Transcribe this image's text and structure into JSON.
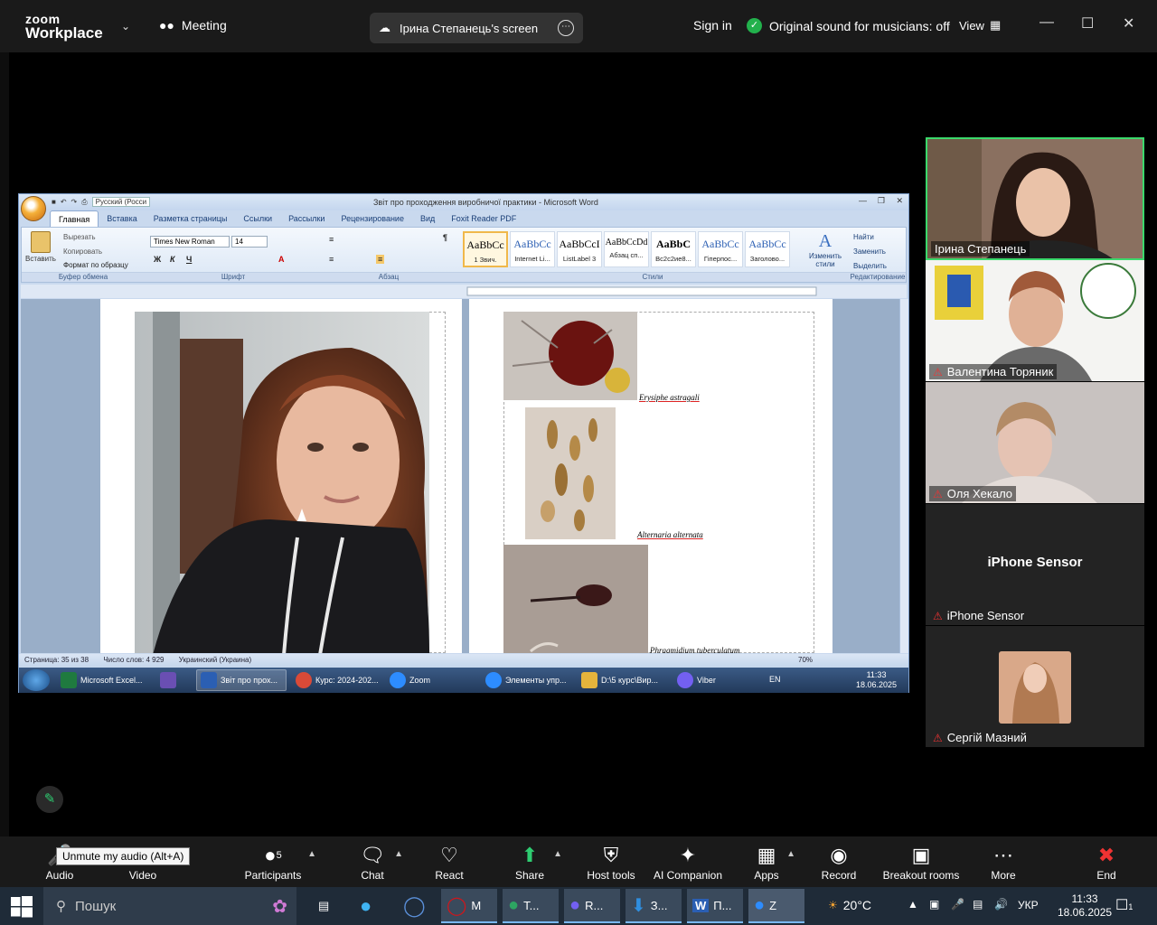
{
  "zoom": {
    "logo_line1": "zoom",
    "logo_line2": "Workplace",
    "meeting_label": "Meeting",
    "share_title": "Ірина Степанець's screen",
    "signin": "Sign in",
    "orig_sound": "Original sound for musicians: off",
    "view": "View",
    "tooltip": "Unmute my audio (Alt+A)",
    "toolbar": {
      "audio": "Audio",
      "video": "Video",
      "participants": "Participants",
      "participants_count": "5",
      "chat": "Chat",
      "react": "React",
      "share": "Share",
      "host_tools": "Host tools",
      "ai_companion": "AI Companion",
      "apps": "Apps",
      "record": "Record",
      "breakout": "Breakout rooms",
      "more": "More",
      "end": "End"
    }
  },
  "participants": [
    {
      "name": "Ірина Степанець",
      "speaking": true,
      "muted": false
    },
    {
      "name": "Валентина Торяник",
      "speaking": false,
      "muted": true
    },
    {
      "name": "Оля Хекало",
      "speaking": false,
      "muted": true
    },
    {
      "name": "iPhone Sensor",
      "speaking": false,
      "muted": true,
      "center_label": "iPhone Sensor"
    },
    {
      "name": "Сергій Мазний",
      "speaking": false,
      "muted": true
    }
  ],
  "word": {
    "title": "Звіт про проходження виробничої практики - Microsoft Word",
    "lang_box": "Русский (Росси",
    "tabs": [
      "Главная",
      "Вставка",
      "Разметка страницы",
      "Ссылки",
      "Рассылки",
      "Рецензирование",
      "Вид",
      "Foxit Reader PDF"
    ],
    "clipboard": {
      "paste": "Вставить",
      "cut": "Вырезать",
      "copy": "Копировать",
      "format": "Формат по образцу",
      "label": "Буфер обмена"
    },
    "font": {
      "name": "Times New Roman",
      "size": "14",
      "label": "Шрифт"
    },
    "paragraph_label": "Абзац",
    "styles": [
      {
        "sample": "AaBbCc",
        "name": "1 Звич."
      },
      {
        "sample": "AaBbCc",
        "name": "Internet Li..."
      },
      {
        "sample": "AaBbCcI",
        "name": "ListLabel 3"
      },
      {
        "sample": "AaBbCcDd",
        "name": "Абзац сп..."
      },
      {
        "sample": "AaBbC",
        "name": "Bс2с2ие8..."
      },
      {
        "sample": "AaBbCc",
        "name": "Гіперпос..."
      },
      {
        "sample": "AaBbCc",
        "name": "Заголово..."
      }
    ],
    "change_styles": "Изменить стили",
    "styles_label": "Стили",
    "editing": {
      "find": "Найти",
      "replace": "Заменить",
      "select": "Выделить",
      "label": "Редактирование"
    },
    "captions": [
      "Erysiphe astragali",
      "Alternaria alternata",
      "Phragmidium tuberculatum"
    ],
    "status": {
      "page": "Страница: 35 из 38",
      "words": "Число слов: 4 929",
      "lang": "Украинский (Украина)",
      "zoom": "70%"
    },
    "taskbar": [
      {
        "label": "Microsoft Excel...",
        "color": "#1f7a3f"
      },
      {
        "label": "",
        "color": "#6a4fb3"
      },
      {
        "label": "Звіт про прох...",
        "color": "#2b5fb3",
        "active": true
      },
      {
        "label": "Курс: 2024-202...",
        "color": "#d94a38"
      },
      {
        "label": "Zoom",
        "color": "#2d8cff"
      },
      {
        "label": "Элементы упр...",
        "color": "#2d8cff"
      },
      {
        "label": "D:\\5 курс\\Вир...",
        "color": "#e5b43c"
      },
      {
        "label": "Viber",
        "color": "#7360f2"
      }
    ],
    "tray_lang": "EN",
    "clock_time": "11:33",
    "clock_date": "18.06.2025"
  },
  "win10": {
    "search": "Пошук",
    "apps": [
      {
        "label": "M",
        "color": "#d0161b"
      },
      {
        "label": "T...",
        "color": "#2da562"
      },
      {
        "label": "R...",
        "color": "#7360f2",
        "badge": "11"
      },
      {
        "label": "З...",
        "color": "#2f8fe0"
      },
      {
        "label": "П...",
        "color": "#2b5fb3"
      },
      {
        "label": "Z",
        "color": "#2d8cff"
      }
    ],
    "temp": "20°C",
    "lang": "УКР",
    "time": "11:33",
    "date": "18.06.2025",
    "notif_count": "1"
  }
}
